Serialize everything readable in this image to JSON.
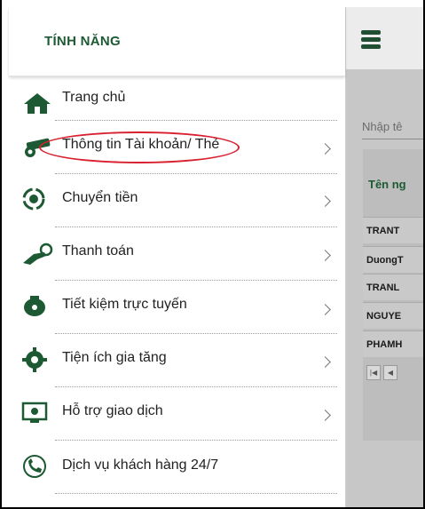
{
  "sidebar": {
    "header_title": "TÍNH NĂNG",
    "items": [
      {
        "label": "Trang chủ",
        "icon": "home-icon",
        "has_chevron": false
      },
      {
        "label": "Thông tin Tài khoản/ Thẻ",
        "icon": "card-account-icon",
        "has_chevron": true
      },
      {
        "label": "Chuyển tiền",
        "icon": "money-transfer-icon",
        "has_chevron": true
      },
      {
        "label": "Thanh toán",
        "icon": "hand-payment-icon",
        "has_chevron": true
      },
      {
        "label": "Tiết kiệm trực tuyến",
        "icon": "piggy-bank-icon",
        "has_chevron": true
      },
      {
        "label": "Tiện ích gia tăng",
        "icon": "gear-icon",
        "has_chevron": true
      },
      {
        "label": "Hỗ trợ giao dịch",
        "icon": "monitor-support-icon",
        "has_chevron": true
      },
      {
        "label": "Dịch vụ khách hàng 24/7",
        "icon": "phone-support-icon",
        "has_chevron": false
      }
    ]
  },
  "main": {
    "search_placeholder": "Nhập tê",
    "table_header": "Tên ng",
    "rows": [
      "TRANT",
      "DuongT",
      "TRANL",
      "NGUYE",
      "PHAMH"
    ],
    "pager": [
      "|◀",
      "◀"
    ]
  },
  "colors": {
    "brand_green": "#1d5a34",
    "annotation_red": "#d8202f",
    "overlay_gray": "#c7c7c7"
  }
}
